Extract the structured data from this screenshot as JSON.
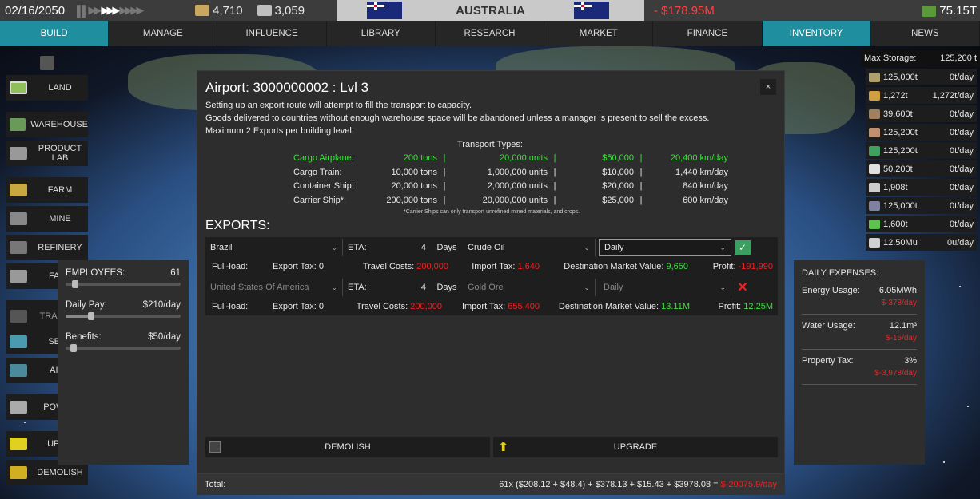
{
  "topbar": {
    "date": "02/16/2050",
    "res1": "4,710",
    "res2": "3,059",
    "country": "AUSTRALIA",
    "balance": "- $178.95M",
    "wealth": "75.15T"
  },
  "nav": [
    "BUILD",
    "MANAGE",
    "INFLUENCE",
    "LIBRARY",
    "RESEARCH",
    "MARKET",
    "FINANCE",
    "INVENTORY",
    "NEWS"
  ],
  "left": [
    "LAND",
    "WAREHOUSE",
    "PRODUCT LAB",
    "FARM",
    "MINE",
    "REFINERY",
    "FACT",
    "TRA STAT",
    "SEAP",
    "AIRP",
    "POWER",
    "UPGR",
    "DEMOLISH"
  ],
  "side": {
    "emp_label": "EMPLOYEES:",
    "emp_val": "61",
    "pay_label": "Daily Pay:",
    "pay_val": "$210/day",
    "ben_label": "Benefits:",
    "ben_val": "$50/day"
  },
  "dialog": {
    "title": "Airport: 3000000002 : Lvl 3",
    "close": "×",
    "line1": "Setting up an export route will attempt to fill the transport to capacity.",
    "line2": "Goods delivered to countries without enough warehouse space will be abandoned unless a manager is present to sell the excess.",
    "line3": "Maximum 2 Exports per building level.",
    "transport_title": "Transport Types:",
    "transports": [
      {
        "name": "Cargo Airplane:",
        "tons": "200 tons",
        "units": "20,000 units",
        "cost": "$50,000",
        "speed": "20,400 km/day"
      },
      {
        "name": "Cargo Train:",
        "tons": "10,000 tons",
        "units": "1,000,000 units",
        "cost": "$10,000",
        "speed": "1,440 km/day"
      },
      {
        "name": "Container Ship:",
        "tons": "20,000 tons",
        "units": "2,000,000 units",
        "cost": "$20,000",
        "speed": "840 km/day"
      },
      {
        "name": "Carrier Ship*:",
        "tons": "200,000 tons",
        "units": "20,000,000 units",
        "cost": "$25,000",
        "speed": "600 km/day"
      }
    ],
    "note": "*Carrier Ships can only transport unrefined mined materials, and crops.",
    "exports_label": "EXPORTS:",
    "exports": [
      {
        "country": "Brazil",
        "eta_label": "ETA:",
        "eta": "4",
        "days": "Days",
        "good": "Crude Oil",
        "freq": "Daily",
        "full": "Full-load:",
        "tax": "Export Tax:  0",
        "travel_label": "Travel Costs:",
        "travel": "200,000",
        "import_label": "Import Tax:",
        "import": "1,640",
        "dmv_label": "Destination Market Value:",
        "dmv": "9,650",
        "profit_label": "Profit:",
        "profit": "-191,990"
      },
      {
        "country": "United States Of America",
        "eta_label": "ETA:",
        "eta": "4",
        "days": "Days",
        "good": "Gold Ore",
        "freq": "Daily",
        "full": "Full-load:",
        "tax": "Export Tax:  0",
        "travel_label": "Travel Costs:",
        "travel": "200,000",
        "import_label": "Import Tax:",
        "import": "655,400",
        "dmv_label": "Destination Market Value:",
        "dmv": "13.11M",
        "profit_label": "Profit:",
        "profit": "12.25M"
      }
    ],
    "demolish": "DEMOLISH",
    "upgrade": "UPGRADE"
  },
  "total": {
    "label": "Total:",
    "formula": "61x ($208.12 + $48.4) + $378.13 + $15.43 + $3978.08 = ",
    "value": "$-20075.9/day"
  },
  "inventory": {
    "max_label": "Max Storage:",
    "max_val": "125,200 t",
    "items": [
      {
        "a": "125,000t",
        "b": "0t/day",
        "c": "#b0a070"
      },
      {
        "a": "1,272t",
        "b": "1,272t/day",
        "c": "#d0a040"
      },
      {
        "a": "39,600t",
        "b": "0t/day",
        "c": "#a08060"
      },
      {
        "a": "125,200t",
        "b": "0t/day",
        "c": "#c09070"
      },
      {
        "a": "125,200t",
        "b": "0t/day",
        "c": "#40a060"
      },
      {
        "a": "50,200t",
        "b": "0t/day",
        "c": "#e0e0e0"
      },
      {
        "a": "1,908t",
        "b": "0t/day",
        "c": "#cccccc"
      },
      {
        "a": "125,000t",
        "b": "0t/day",
        "c": "#8080a0"
      },
      {
        "a": "1,600t",
        "b": "0t/day",
        "c": "#60c050"
      },
      {
        "a": "12.50Mu",
        "b": "0u/day",
        "c": "#d0d0d0"
      }
    ]
  },
  "expenses": {
    "title": "DAILY EXPENSES:",
    "energy_label": "Energy Usage:",
    "energy": "6.05MWh",
    "energy_cost": "$-378/day",
    "water_label": "Water Usage:",
    "water": "12.1m³",
    "water_cost": "$-15/day",
    "prop_label": "Property Tax:",
    "prop": "3%",
    "prop_cost": "$-3,978/day"
  }
}
